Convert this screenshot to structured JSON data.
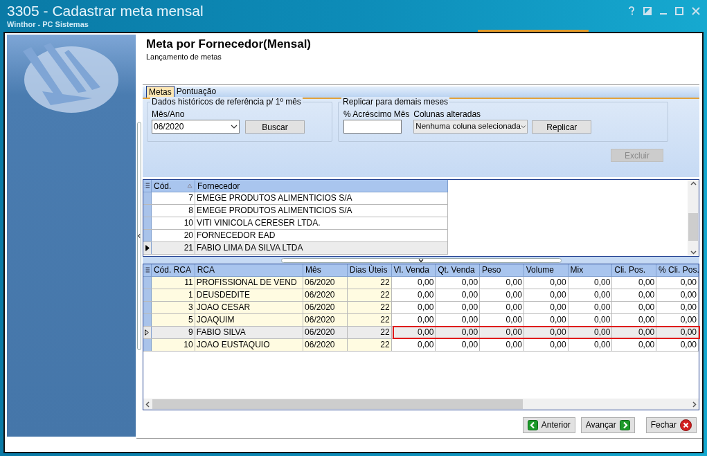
{
  "window": {
    "title": "3305 - Cadastrar meta mensal",
    "subtitle": "Winthor - PC Sistemas"
  },
  "header": {
    "title": "Meta por Fornecedor(Mensal)",
    "subtitle": "Lançamento de metas"
  },
  "tabs": [
    {
      "label": "Metas",
      "selected": true
    },
    {
      "label": "Pontuação",
      "selected": false
    }
  ],
  "historico": {
    "legend": "Dados históricos de referência p/ 1º mês",
    "field_label": "Mês/Ano",
    "value": "06/2020",
    "button": "Buscar"
  },
  "replicar": {
    "legend": "Replicar para demais meses",
    "percent_label": "% Acréscimo Mês",
    "columns_label": "Colunas alteradas",
    "columns_value": "Nenhuma coluna selecionada",
    "button": "Replicar"
  },
  "excluir": {
    "label": "Excluir",
    "disabled": true
  },
  "fornecedores": {
    "columns": [
      "Cód.",
      "Fornecedor"
    ],
    "rows": [
      {
        "cells": [
          "7",
          "EMEGE PRODUTOS ALIMENTICIOS S/A"
        ],
        "selected": false
      },
      {
        "cells": [
          "8",
          "EMEGE PRODUTOS ALIMENTICIOS S/A"
        ],
        "selected": false
      },
      {
        "cells": [
          "10",
          "VITI VINICOLA CERESER LTDA."
        ],
        "selected": false
      },
      {
        "cells": [
          "20",
          "FORNECEDOR EAD"
        ],
        "selected": false
      },
      {
        "cells": [
          "21",
          "FABIO LIMA DA SILVA LTDA"
        ],
        "selected": true
      }
    ]
  },
  "rcas": {
    "columns": [
      "Cód. RCA",
      "RCA",
      "Mês",
      "Dias Ùteis",
      "Vl. Venda",
      "Qt. Venda",
      "Peso",
      "Volume",
      "Mix",
      "Cli. Pos.",
      "% Cli. Pos."
    ],
    "rows": [
      {
        "cells": [
          "11",
          "PROFISSIONAL DE VEND",
          "06/2020",
          "22",
          "0,00",
          "0,00",
          "0,00",
          "0,00",
          "0,00",
          "0,00",
          "0,00"
        ],
        "selected": false,
        "outlined": false
      },
      {
        "cells": [
          "1",
          "DEUSDEDITE",
          "06/2020",
          "22",
          "0,00",
          "0,00",
          "0,00",
          "0,00",
          "0,00",
          "0,00",
          "0,00"
        ],
        "selected": false,
        "outlined": false
      },
      {
        "cells": [
          "3",
          "JOAO CESAR",
          "06/2020",
          "22",
          "0,00",
          "0,00",
          "0,00",
          "0,00",
          "0,00",
          "0,00",
          "0,00"
        ],
        "selected": false,
        "outlined": false
      },
      {
        "cells": [
          "5",
          "JOAQUIM",
          "06/2020",
          "22",
          "0,00",
          "0,00",
          "0,00",
          "0,00",
          "0,00",
          "0,00",
          "0,00"
        ],
        "selected": false,
        "outlined": false
      },
      {
        "cells": [
          "9",
          "FABIO SILVA",
          "06/2020",
          "22",
          "0,00",
          "0,00",
          "0,00",
          "0,00",
          "0,00",
          "0,00",
          "0,00"
        ],
        "selected": true,
        "outlined": true
      },
      {
        "cells": [
          "10",
          "JOAO EUSTAQUIO",
          "06/2020",
          "22",
          "0,00",
          "0,00",
          "0,00",
          "0,00",
          "0,00",
          "0,00",
          "0,00"
        ],
        "selected": false,
        "outlined": false
      }
    ]
  },
  "buttons": [
    {
      "label": "Anterior",
      "kind": "back"
    },
    {
      "label": "Avançar",
      "kind": "next"
    },
    {
      "label": "Fechar",
      "kind": "close"
    }
  ]
}
